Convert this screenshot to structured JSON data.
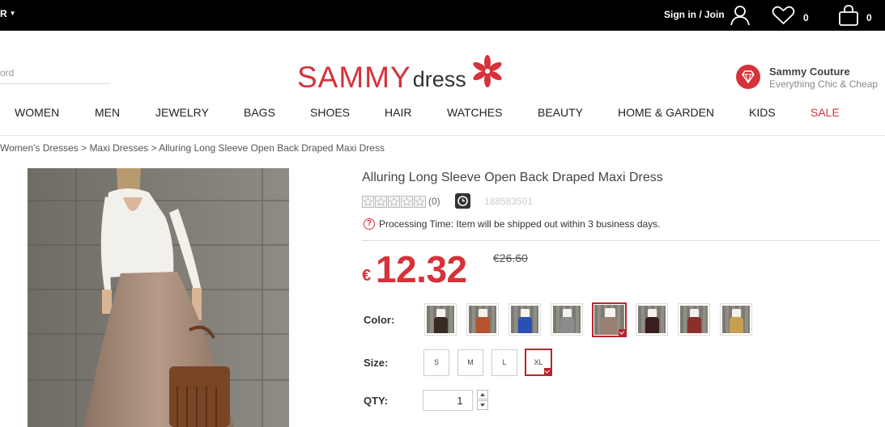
{
  "topbar": {
    "currency": "R",
    "signin": "Sign in / Join",
    "wishlist_count": "0",
    "bag_count": "0"
  },
  "header": {
    "search_placeholder": "ord",
    "logo_main": "SAMMY",
    "logo_sub": "dress",
    "couture_title": "Sammy Couture",
    "couture_sub": "Everything Chic & Cheap",
    "brand_color": "#d6323a"
  },
  "nav": {
    "items": [
      "WOMEN",
      "MEN",
      "JEWELRY",
      "BAGS",
      "SHOES",
      "HAIR",
      "WATCHES",
      "BEAUTY",
      "HOME & GARDEN",
      "KIDS",
      "SALE"
    ]
  },
  "breadcrumb": "Women's Dresses > Maxi Dresses > Alluring Long Sleeve Open Back Draped Maxi Dress",
  "product": {
    "title": "Alluring Long Sleeve Open Back Draped Maxi Dress",
    "review_count": "(0)",
    "sku": "188583501",
    "processing": "Processing Time: Item will be shipped out within 3 business days.",
    "currency_symbol": "€",
    "price": "12.32",
    "old_price": "€26.60",
    "color_label": "Color:",
    "size_label": "Size:",
    "qty_label": "QTY:",
    "qty_value": "1",
    "colors": [
      "#3a2a24",
      "#b5532e",
      "#2a4fb5",
      "#8c8c8c",
      "#9a8070",
      "#3a1e1e",
      "#8a2f2a",
      "#c4a050"
    ],
    "selected_color_index": 4,
    "sizes": [
      "S",
      "M",
      "L",
      "XL"
    ],
    "selected_size": "XL"
  }
}
